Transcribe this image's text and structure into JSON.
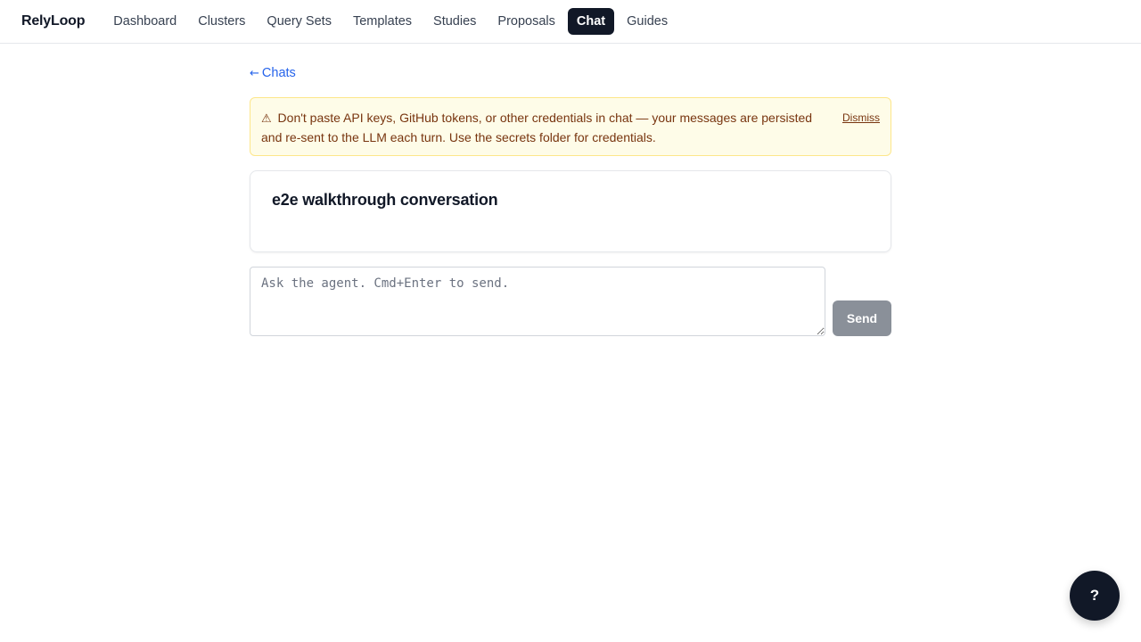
{
  "nav": {
    "brand": "RelyLoop",
    "items": [
      {
        "label": "Dashboard",
        "active": false
      },
      {
        "label": "Clusters",
        "active": false
      },
      {
        "label": "Query Sets",
        "active": false
      },
      {
        "label": "Templates",
        "active": false
      },
      {
        "label": "Studies",
        "active": false
      },
      {
        "label": "Proposals",
        "active": false
      },
      {
        "label": "Chat",
        "active": true
      },
      {
        "label": "Guides",
        "active": false
      }
    ]
  },
  "back_link": {
    "arrow": "←",
    "label": "Chats"
  },
  "warning": {
    "icon": "⚠",
    "text": "Don't paste API keys, GitHub tokens, or other credentials in chat — your messages are persisted and re-sent to the LLM each turn. Use the secrets folder for credentials.",
    "dismiss_label": "Dismiss"
  },
  "conversation": {
    "title": "e2e walkthrough conversation"
  },
  "composer": {
    "value": "",
    "placeholder": "Ask the agent. Cmd+Enter to send.",
    "send_label": "Send"
  },
  "help": {
    "label": "?"
  },
  "colors": {
    "nav_active_bg": "#111827",
    "link": "#2563eb",
    "warning_bg": "#fefce8",
    "warning_border": "#fde68a",
    "warning_text": "#78350f",
    "send_disabled_bg": "#8a9099"
  }
}
